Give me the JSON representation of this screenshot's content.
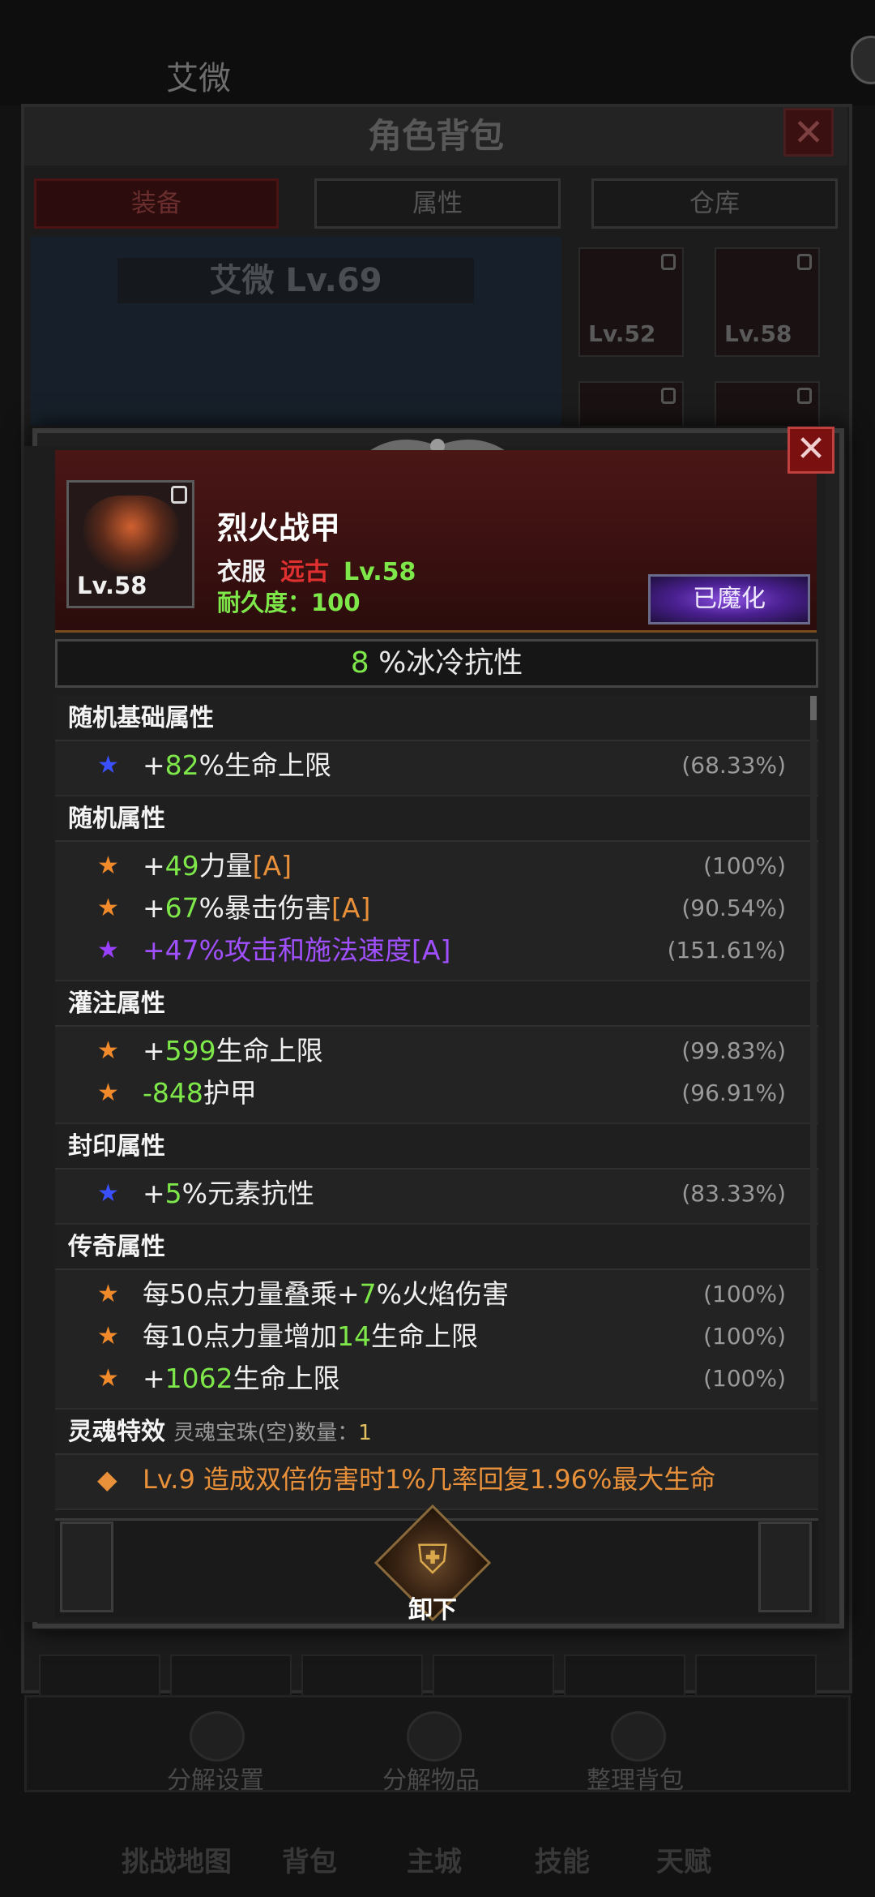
{
  "background": {
    "character_name": "艾微",
    "window_title": "角色背包",
    "tabs": [
      {
        "label": "装备",
        "active": true
      },
      {
        "label": "属性",
        "active": false
      },
      {
        "label": "仓库",
        "active": false
      }
    ],
    "hero_name_level": "艾微 Lv.69",
    "slots": [
      {
        "level": "Lv.52"
      },
      {
        "level": "Lv.58"
      }
    ],
    "actions": [
      {
        "label": "分解设置",
        "icon": "gear-icon"
      },
      {
        "label": "分解物品",
        "icon": "decompose-icon"
      },
      {
        "label": "整理背包",
        "icon": "sort-bag-icon"
      }
    ],
    "nav": [
      "挑战地图",
      "背包",
      "主城",
      "技能",
      "天赋"
    ]
  },
  "item": {
    "name": "烈火战甲",
    "type": "衣服",
    "rarity": "远古",
    "rarity_color": "#e03030",
    "level": "Lv.58",
    "icon_level": "Lv.58",
    "durability": "耐久度：100",
    "enchant_label": "已魔化",
    "main_stat_value": "8",
    "main_stat_text": " %冰冷抗性"
  },
  "sections": [
    {
      "title": "随机基础属性",
      "lines": [
        {
          "star": "blue",
          "prefix": "+",
          "value": "82",
          "text": "%生命上限",
          "tag": "",
          "pct": "(68.33%)"
        }
      ]
    },
    {
      "title": "随机属性",
      "lines": [
        {
          "star": "orange",
          "prefix": "+",
          "value": "49",
          "text": "力量",
          "tag": "[A]",
          "pct": "(100%)"
        },
        {
          "star": "orange",
          "prefix": "+",
          "value": "67",
          "text": "%暴击伤害",
          "tag": "[A]",
          "pct": "(90.54%)"
        },
        {
          "star": "purple",
          "prefix": "+47%攻击和施法速度",
          "value": "",
          "text": "",
          "tag": "[A]",
          "pct": "(151.61%)"
        }
      ]
    },
    {
      "title": "灌注属性",
      "lines": [
        {
          "star": "orange",
          "prefix": "+",
          "value": "599",
          "text": "生命上限",
          "tag": "",
          "pct": "(99.83%)"
        },
        {
          "star": "orange",
          "prefix": "",
          "value": "-848",
          "text": "护甲",
          "tag": "",
          "pct": "(96.91%)"
        }
      ]
    },
    {
      "title": "封印属性",
      "lines": [
        {
          "star": "blue",
          "prefix": "+",
          "value": "5",
          "text": "%元素抗性",
          "tag": "",
          "pct": "(83.33%)"
        }
      ]
    },
    {
      "title": "传奇属性",
      "lines": [
        {
          "star": "orange",
          "prefix": "每50点力量叠乘+",
          "value": "7",
          "text": "%火焰伤害",
          "tag": "",
          "pct": "(100%)"
        },
        {
          "star": "orange",
          "prefix": "每10点力量增加",
          "value": "14",
          "text": "生命上限",
          "tag": "",
          "pct": "(100%)"
        },
        {
          "star": "orange",
          "prefix": "+",
          "value": "1062",
          "text": "生命上限",
          "tag": "",
          "pct": "(100%)"
        }
      ]
    }
  ],
  "soul": {
    "title": "灵魂特效",
    "count_label": "灵魂宝珠(空)数量：",
    "count": "1",
    "effect": "Lv.9 造成双倍伤害时1%几率回复1.96%最大生命"
  },
  "footer": {
    "unequip_label": "卸下"
  }
}
